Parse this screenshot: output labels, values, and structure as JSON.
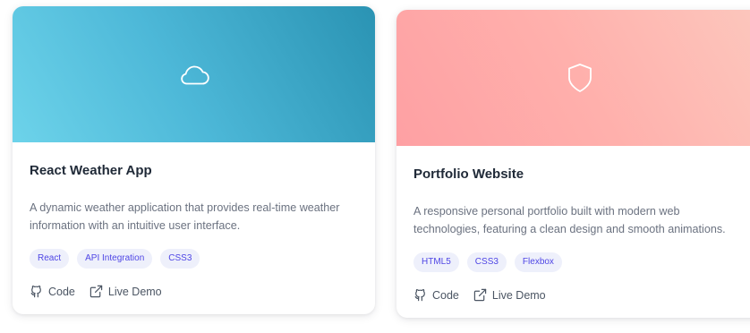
{
  "colors": {
    "tag_bg": "#eef0fb",
    "tag_text": "#4f46e5",
    "title": "#1f2937",
    "description": "#6b7280"
  },
  "projects": [
    {
      "banner_icon": "cloud-icon",
      "banner_colors": [
        "#6dd3ea",
        "#2a93b3"
      ],
      "title": "React Weather App",
      "description_lines": [
        "A dynamic weather application that provides real-time weather",
        "information with an intuitive user interface."
      ],
      "tags": [
        "React",
        "API Integration",
        "CSS3"
      ],
      "links": {
        "code": "Code",
        "live_demo": "Live Demo"
      }
    },
    {
      "banner_icon": "shield-icon",
      "banner_colors": [
        "#fea0a3",
        "#fcc7bd"
      ],
      "title": "Portfolio Website",
      "description_lines": [
        "A responsive personal portfolio built with modern web",
        "technologies, featuring a clean design and smooth animations."
      ],
      "tags": [
        "HTML5",
        "CSS3",
        "Flexbox"
      ],
      "links": {
        "code": "Code",
        "live_demo": "Live Demo"
      }
    }
  ]
}
